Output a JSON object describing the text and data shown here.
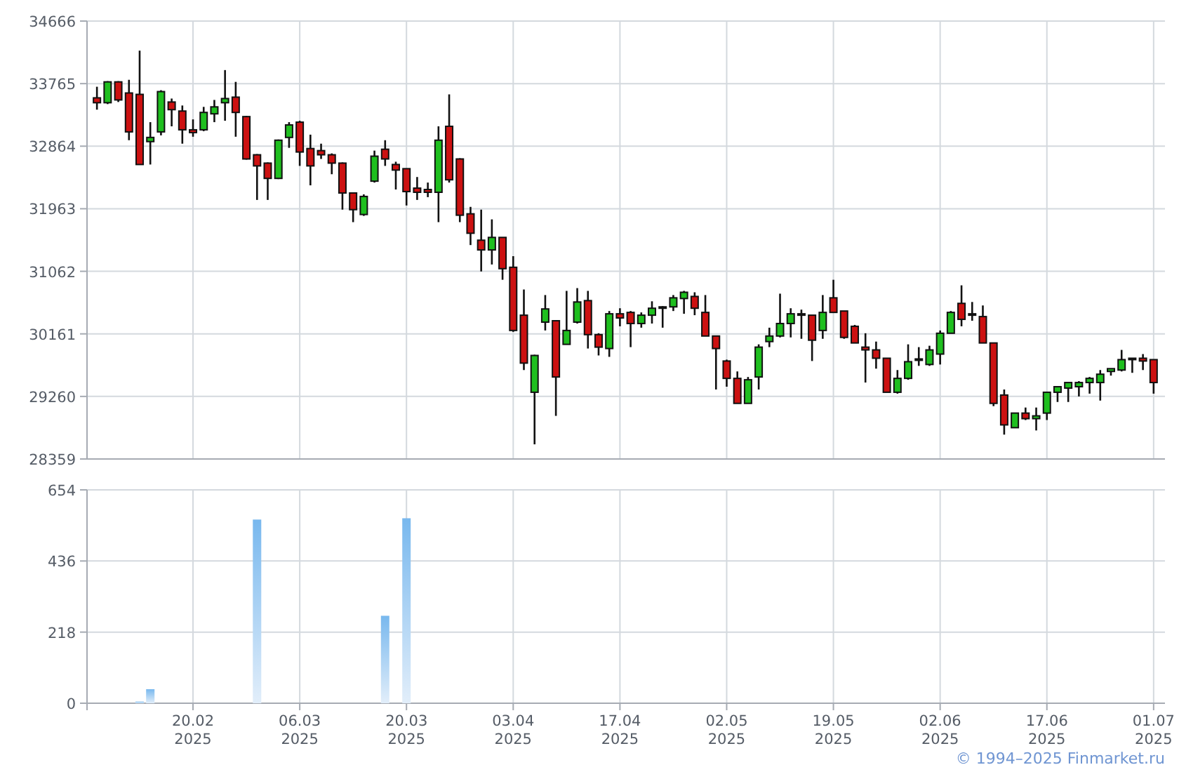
{
  "price_chart": {
    "chart_data": {
      "type": "candlestick",
      "grid": true,
      "ylim": [
        28359,
        34666
      ],
      "yticks": [
        28359,
        29260,
        30161,
        31062,
        31963,
        32864,
        33765,
        34666
      ],
      "categories": [
        null,
        null,
        null,
        null,
        null,
        null,
        null,
        null,
        null,
        null,
        null,
        null,
        null,
        null,
        null,
        null,
        null,
        null,
        null,
        null,
        null,
        null,
        null,
        null,
        null,
        null,
        null,
        null,
        null,
        null,
        null,
        null,
        null,
        null,
        null,
        null,
        null,
        null,
        null,
        null,
        null,
        null,
        null,
        null,
        null,
        null,
        null,
        null,
        null,
        null,
        null,
        null,
        null,
        null,
        null,
        null,
        null,
        null,
        null,
        null,
        null,
        null,
        null,
        null,
        null,
        null,
        null,
        null,
        null,
        null,
        null,
        null,
        null,
        null,
        null,
        null,
        null,
        null,
        null,
        null,
        null,
        null,
        null,
        null,
        null,
        null,
        null,
        null,
        null,
        null,
        null,
        null,
        null,
        null,
        null,
        null,
        null,
        null,
        null,
        null
      ],
      "ohlc": [
        [
          33560,
          33720,
          33390,
          33490
        ],
        [
          33490,
          33800,
          33470,
          33790
        ],
        [
          33790,
          33800,
          33500,
          33530
        ],
        [
          33630,
          33820,
          32950,
          33070
        ],
        [
          33610,
          34240,
          32600,
          32600
        ],
        [
          32930,
          33210,
          32600,
          32990
        ],
        [
          33070,
          33670,
          33020,
          33650
        ],
        [
          33500,
          33550,
          33150,
          33390
        ],
        [
          33370,
          33450,
          32900,
          33100
        ],
        [
          33100,
          33250,
          33000,
          33060
        ],
        [
          33100,
          33430,
          33080,
          33350
        ],
        [
          33330,
          33530,
          33210,
          33430
        ],
        [
          33490,
          33960,
          33230,
          33550
        ],
        [
          33570,
          33790,
          33000,
          33350
        ],
        [
          33290,
          33300,
          32670,
          32680
        ],
        [
          32740,
          32750,
          32090,
          32580
        ],
        [
          32620,
          32630,
          32090,
          32400
        ],
        [
          32400,
          32960,
          32390,
          32950
        ],
        [
          32990,
          33210,
          32840,
          33170
        ],
        [
          33210,
          33230,
          32580,
          32780
        ],
        [
          32830,
          33030,
          32300,
          32580
        ],
        [
          32800,
          32900,
          32680,
          32740
        ],
        [
          32740,
          32760,
          32460,
          32620
        ],
        [
          32620,
          32630,
          31950,
          32190
        ],
        [
          32190,
          32200,
          31770,
          31950
        ],
        [
          31880,
          32170,
          31860,
          32140
        ],
        [
          32360,
          32800,
          32340,
          32720
        ],
        [
          32820,
          32950,
          32580,
          32680
        ],
        [
          32600,
          32640,
          32240,
          32520
        ],
        [
          32540,
          32540,
          32010,
          32210
        ],
        [
          32260,
          32420,
          32090,
          32200
        ],
        [
          32240,
          32340,
          32130,
          32200
        ],
        [
          32200,
          33150,
          31770,
          32950
        ],
        [
          33150,
          33610,
          32340,
          32380
        ],
        [
          32680,
          32690,
          31770,
          31870
        ],
        [
          31890,
          31990,
          31440,
          31610
        ],
        [
          31510,
          31950,
          31060,
          31370
        ],
        [
          31370,
          31810,
          31160,
          31550
        ],
        [
          31550,
          31550,
          30940,
          31100
        ],
        [
          31120,
          31280,
          30190,
          30210
        ],
        [
          30430,
          30800,
          29640,
          29740
        ],
        [
          29320,
          29860,
          28570,
          29850
        ],
        [
          30330,
          30720,
          30210,
          30520
        ],
        [
          30350,
          30360,
          28980,
          29540
        ],
        [
          30010,
          30780,
          30010,
          30210
        ],
        [
          30330,
          30820,
          30310,
          30620
        ],
        [
          30640,
          30780,
          29950,
          30150
        ],
        [
          30150,
          30170,
          29850,
          29970
        ],
        [
          29950,
          30490,
          29830,
          30450
        ],
        [
          30450,
          30530,
          30270,
          30390
        ],
        [
          30470,
          30490,
          29970,
          30310
        ],
        [
          30310,
          30470,
          30250,
          30430
        ],
        [
          30430,
          30630,
          30310,
          30530
        ],
        [
          30530,
          30560,
          30250,
          30550
        ],
        [
          30550,
          30720,
          30490,
          30680
        ],
        [
          30670,
          30780,
          30450,
          30760
        ],
        [
          30700,
          30760,
          30430,
          30530
        ],
        [
          30470,
          30720,
          30130,
          30130
        ],
        [
          30130,
          30130,
          29360,
          29950
        ],
        [
          29770,
          29790,
          29400,
          29520
        ],
        [
          29520,
          29620,
          29160,
          29160
        ],
        [
          29160,
          29540,
          29160,
          29500
        ],
        [
          29540,
          30010,
          29360,
          29970
        ],
        [
          30050,
          30250,
          29970,
          30130
        ],
        [
          30130,
          30740,
          30110,
          30310
        ],
        [
          30310,
          30530,
          30110,
          30450
        ],
        [
          30430,
          30510,
          30090,
          30450
        ],
        [
          30430,
          30430,
          29770,
          30070
        ],
        [
          30210,
          30720,
          30090,
          30470
        ],
        [
          30680,
          30940,
          30470,
          30470
        ],
        [
          30490,
          30490,
          30090,
          30110
        ],
        [
          30270,
          30290,
          30030,
          30030
        ],
        [
          29970,
          30170,
          29460,
          29930
        ],
        [
          29930,
          30050,
          29660,
          29810
        ],
        [
          29810,
          29810,
          29320,
          29320
        ],
        [
          29320,
          29640,
          29300,
          29520
        ],
        [
          29520,
          30010,
          29500,
          29760
        ],
        [
          29780,
          29970,
          29700,
          29800
        ],
        [
          29720,
          29990,
          29700,
          29930
        ],
        [
          29870,
          30210,
          29720,
          30170
        ],
        [
          30170,
          30490,
          30170,
          30470
        ],
        [
          30600,
          30860,
          30270,
          30370
        ],
        [
          30450,
          30620,
          30350,
          30430
        ],
        [
          30410,
          30570,
          30030,
          30030
        ],
        [
          30030,
          30030,
          29120,
          29160
        ],
        [
          29280,
          29360,
          28710,
          28850
        ],
        [
          28810,
          29020,
          28810,
          29020
        ],
        [
          29020,
          29100,
          28920,
          28940
        ],
        [
          28940,
          29100,
          28770,
          28980
        ],
        [
          29020,
          29320,
          28920,
          29320
        ],
        [
          29320,
          29400,
          29180,
          29400
        ],
        [
          29380,
          29460,
          29180,
          29460
        ],
        [
          29400,
          29480,
          29260,
          29460
        ],
        [
          29460,
          29540,
          29300,
          29520
        ],
        [
          29460,
          29640,
          29200,
          29580
        ],
        [
          29620,
          29660,
          29560,
          29660
        ],
        [
          29640,
          29930,
          29620,
          29790
        ],
        [
          29790,
          29810,
          29600,
          29810
        ],
        [
          29810,
          29870,
          29640,
          29770
        ],
        [
          29790,
          29790,
          29300,
          29460
        ]
      ]
    }
  },
  "volume_chart": {
    "chart_data": {
      "type": "bar",
      "grid": true,
      "ylim": [
        0,
        654
      ],
      "yticks": [
        0,
        218,
        436,
        654
      ],
      "categories": [
        null,
        null,
        null,
        null,
        null,
        null,
        null,
        null,
        null,
        "20.02\n2025",
        null,
        null,
        null,
        null,
        null,
        null,
        null,
        null,
        null,
        "06.03\n2025",
        null,
        null,
        null,
        null,
        null,
        null,
        null,
        null,
        null,
        "20.03\n2025",
        null,
        null,
        null,
        null,
        null,
        null,
        null,
        null,
        null,
        "03.04\n2025",
        null,
        null,
        null,
        null,
        null,
        null,
        null,
        null,
        null,
        "17.04\n2025",
        null,
        null,
        null,
        null,
        null,
        null,
        null,
        null,
        null,
        "02.05\n2025",
        null,
        null,
        null,
        null,
        null,
        null,
        null,
        null,
        null,
        "19.05\n2025",
        null,
        null,
        null,
        null,
        null,
        null,
        null,
        null,
        null,
        "02.06\n2025",
        null,
        null,
        null,
        null,
        null,
        null,
        null,
        null,
        null,
        "17.06\n2025",
        null,
        null,
        null,
        null,
        null,
        null,
        null,
        null,
        null,
        "01.07\n2025"
      ],
      "series": [
        {
          "color": "#78b8ee",
          "values": [
            0,
            0,
            0,
            0,
            5,
            43,
            0,
            0,
            0,
            0,
            0,
            0,
            0,
            0,
            0,
            563,
            0,
            0,
            0,
            0,
            0,
            0,
            0,
            0,
            0,
            0,
            0,
            268,
            0,
            567,
            0,
            0,
            0,
            0,
            0,
            0,
            0,
            0,
            0,
            0,
            0,
            0,
            0,
            0,
            0,
            0,
            0,
            0,
            0,
            0,
            0,
            0,
            0,
            0,
            0,
            0,
            0,
            0,
            0,
            0,
            0,
            0,
            0,
            0,
            0,
            0,
            0,
            0,
            0,
            0,
            0,
            0,
            0,
            0,
            0,
            0,
            0,
            0,
            0,
            0,
            0,
            0,
            0,
            0,
            0,
            0,
            0,
            0,
            0,
            0,
            0,
            0,
            0,
            0,
            0,
            0,
            0,
            0,
            0,
            0
          ]
        }
      ]
    }
  },
  "copyright": "© 1994–2025 Finmarket.ru"
}
